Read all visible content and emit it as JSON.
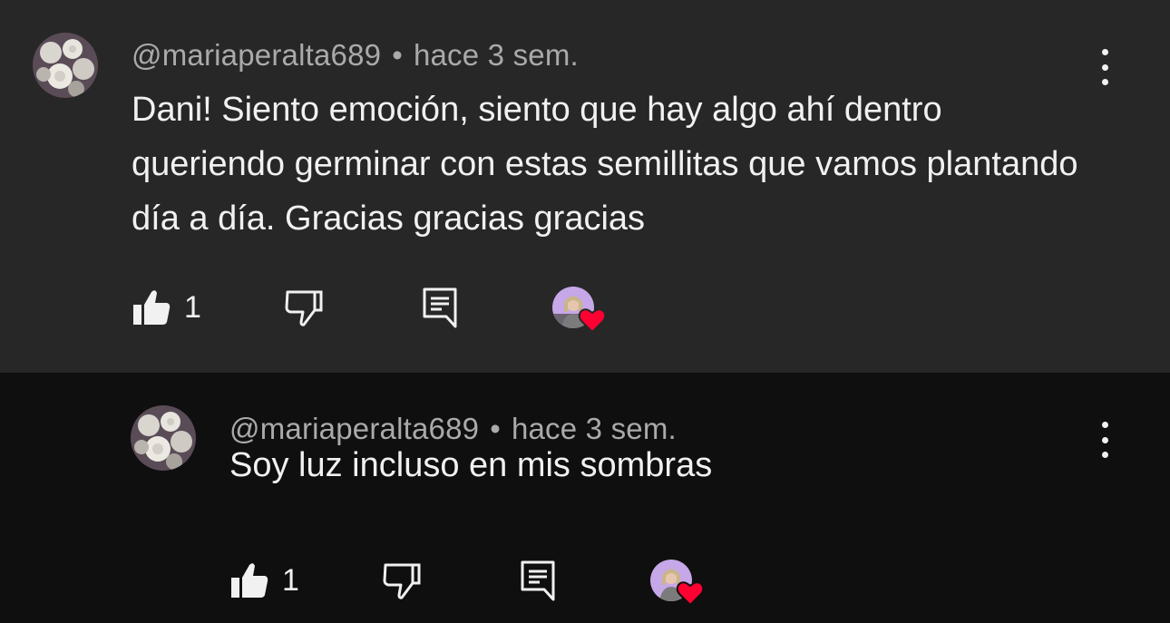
{
  "comments": [
    {
      "author": "@mariaperalta689",
      "separator": "•",
      "time": "hace 3 sem.",
      "text": "Dani! Siento emoción, siento que hay algo ahí dentro queriendo germinar con estas semillitas que vamos plantando día a día. Gracias gracias gracias",
      "likes": "1",
      "creator_hearted": true,
      "icons": {
        "like": "thumbs-up-icon",
        "dislike": "thumbs-down-icon",
        "reply": "reply-comment-icon",
        "menu": "more-vertical-icon"
      }
    },
    {
      "author": "@mariaperalta689",
      "separator": "•",
      "time": "hace 3 sem.",
      "text": "Soy luz incluso en mis sombras",
      "likes": "1",
      "creator_hearted": true
    }
  ],
  "colors": {
    "top_background": "#272727",
    "reply_background": "#0f0f0f",
    "text_primary": "#f1f1f1",
    "text_secondary": "#aaaaaa",
    "heart": "#ff0033"
  }
}
